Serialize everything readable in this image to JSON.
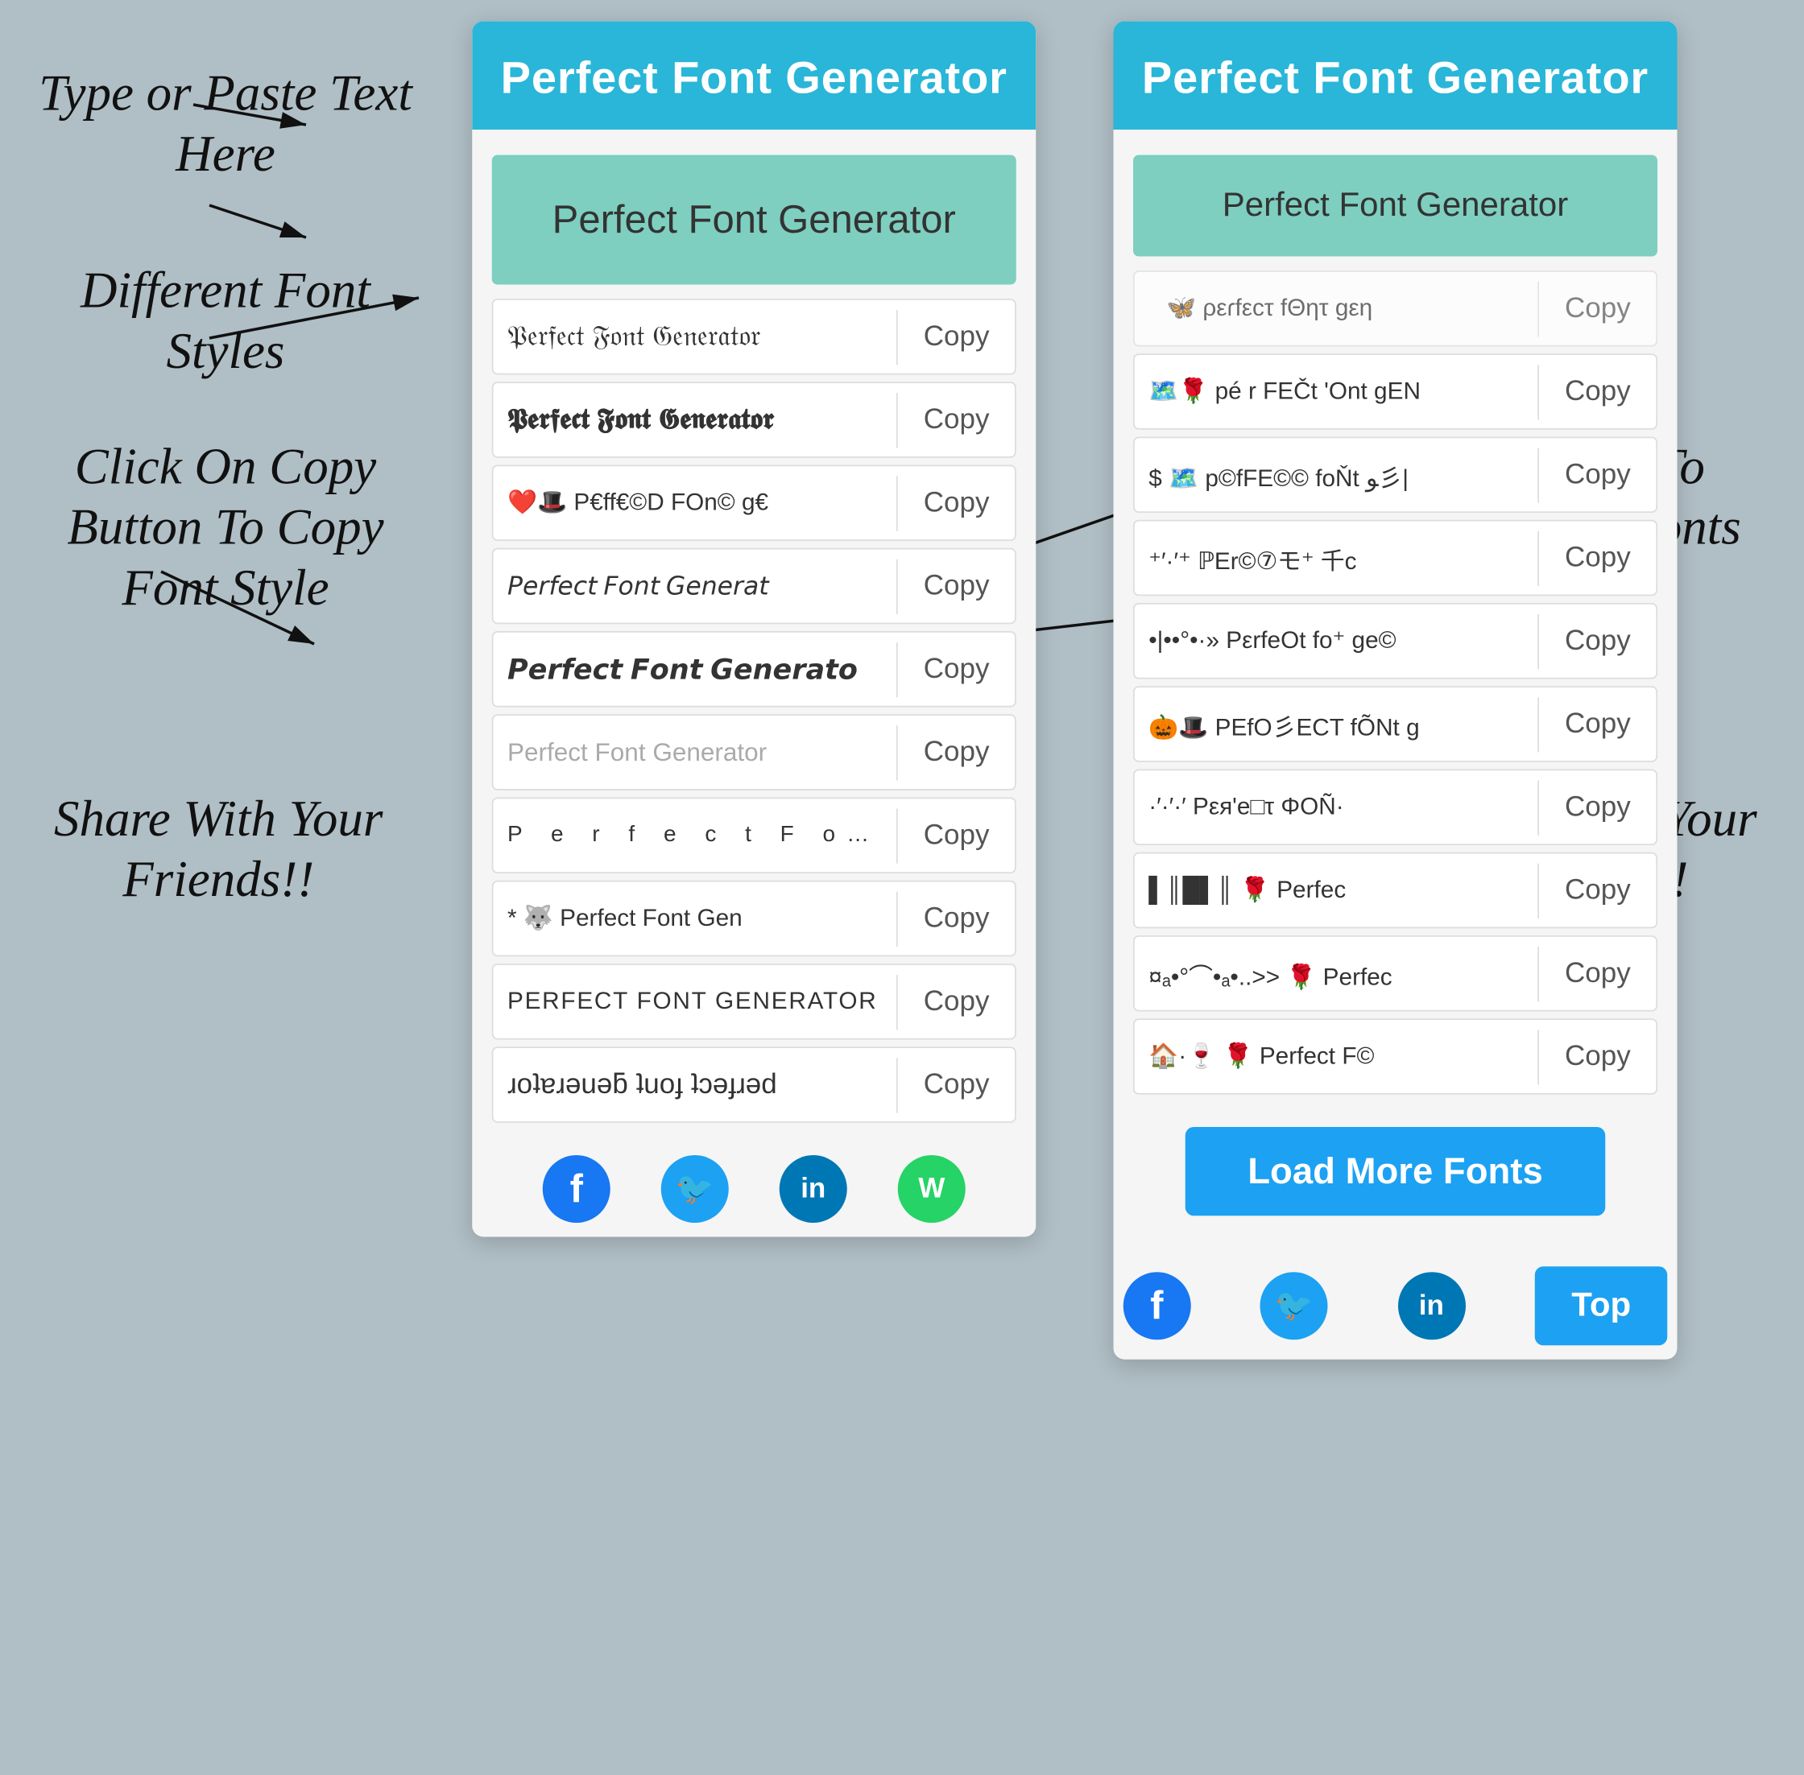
{
  "background": "#b0bec5",
  "annotations": {
    "type_paste": "Type or Paste Text\nHere",
    "different_fonts": "Different Font\nStyles",
    "click_copy": "Click On Copy\nButton To Copy\nFont Style",
    "share_left": "Share With\nYour\nFriends!!",
    "click_load": "Click Here To\nLoad More\nFonts",
    "share_right": "Share With\nYour\nFriends!!"
  },
  "left_panel": {
    "header": "Perfect Font Generator",
    "input": "Perfect Font Generator",
    "rows": [
      {
        "text": "𝔓𝔢𝔯𝔣𝔢𝔠𝔱 𝔉𝔬𝔫𝔱 𝔊𝔢𝔫𝔢𝔯𝔞𝔱𝔬𝔯",
        "copy": "Copy",
        "style": ""
      },
      {
        "text": "𝕻𝖊𝖗𝖋𝖊𝖈𝖙 𝕱𝖔𝖓𝖙 𝕲𝖊𝖓𝖊𝖗𝖆𝖙𝖔𝖗",
        "copy": "Copy",
        "style": ""
      },
      {
        "text": "❤️🎩 P€ff€©D FOn© g€",
        "copy": "Copy",
        "style": "font-small-emoji"
      },
      {
        "text": "𝘗𝘦𝘳𝘧𝘦𝘤𝘵 𝘍𝘰𝘯𝘵 𝘎𝘦𝘯𝘦𝘳𝘢𝘵",
        "copy": "Copy",
        "style": "font-italic-serif"
      },
      {
        "text": "𝙋𝙚𝙧𝙛𝙚𝙘𝙩 𝙁𝙤𝙣𝙩 𝙂𝙚𝙣𝙚𝙧𝙖𝙩𝙤",
        "copy": "Copy",
        "style": ""
      },
      {
        "text": "Perfect Font Generator",
        "copy": "Copy",
        "style": "font-light"
      },
      {
        "text": "P e r f e c t  F o n t",
        "copy": "Copy",
        "style": "font-spaced"
      },
      {
        "text": "* 🐺 Perfect Font Gen",
        "copy": "Copy",
        "style": "font-small-emoji"
      },
      {
        "text": "PERFECT FONT GENERATOR",
        "copy": "Copy",
        "style": "font-caps"
      },
      {
        "text": "ɹoʇɐɹǝuǝƃ ʇuoɟ ʇɔǝɟɹǝd",
        "copy": "Copy",
        "style": ""
      }
    ],
    "share_icons": [
      "fb",
      "tw",
      "li",
      "wa"
    ]
  },
  "right_panel": {
    "header": "Perfect Font Generator",
    "input": "Perfect Font Generator",
    "rows": [
      {
        "text": "⠀🦋 ρεɾfεcτ fΘητ gεη",
        "copy": "Copy",
        "style": "partial-row font-small-emoji"
      },
      {
        "text": "🗺️🌹 pé r FEČt 'Ont gEN",
        "copy": "Copy",
        "style": "font-small-emoji"
      },
      {
        "text": "$ 🗺️ p©fFE©© foŇt ﻮ彡|",
        "copy": "Copy",
        "style": "font-small-emoji"
      },
      {
        "text": "⁺′·′⁺ ℙEr©⑦モ⁺ 千c",
        "copy": "Copy",
        "style": "font-small-emoji"
      },
      {
        "text": "•|••°•·» PεrfeOt fo⁺ ge©",
        "copy": "Copy",
        "style": "font-small-emoji"
      },
      {
        "text": "🎃🎩 PEfO彡ECT fÕNt g",
        "copy": "Copy",
        "style": "font-small-emoji"
      },
      {
        "text": "·′·′·′ Pεя'e□τ ΦOÑ·",
        "copy": "Copy",
        "style": "font-small-emoji"
      },
      {
        "text": "▌║█▌║ 🌹 Perfec",
        "copy": "Copy",
        "style": "font-small-emoji"
      },
      {
        "text": "¤ₐ•°⌒•ₐ•..>> 🌹 Perfec",
        "copy": "Copy",
        "style": "font-small-emoji"
      },
      {
        "text": "🏠·🍷 🌹 Perfect F©",
        "copy": "Copy",
        "style": "font-small-emoji"
      }
    ],
    "load_more": "Load More Fonts",
    "top_btn": "Top",
    "share_icons": [
      "fb",
      "tw",
      "li"
    ]
  },
  "share_icon_labels": {
    "fb": "f",
    "tw": "🐦",
    "li": "in",
    "wa": "W"
  }
}
